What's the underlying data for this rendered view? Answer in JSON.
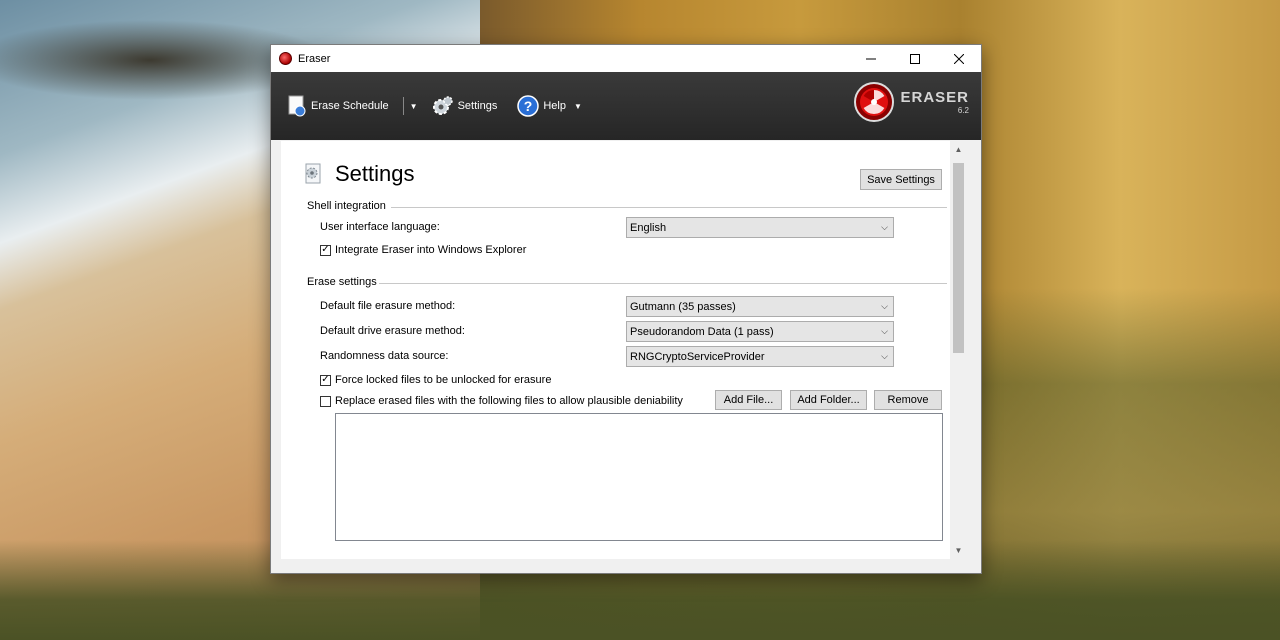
{
  "window": {
    "title": "Eraser"
  },
  "toolbar": {
    "erase_schedule": "Erase Schedule",
    "settings": "Settings",
    "help": "Help",
    "brand_name": "ERASER",
    "brand_version": "6.2"
  },
  "page": {
    "heading": "Settings",
    "save_button": "Save Settings"
  },
  "shell": {
    "title": "Shell integration",
    "language_label": "User interface language:",
    "language_value": "English",
    "integrate_label": "Integrate Eraser into Windows Explorer",
    "integrate_checked": true
  },
  "erase": {
    "title": "Erase settings",
    "file_method_label": "Default file erasure method:",
    "file_method_value": "Gutmann (35 passes)",
    "drive_method_label": "Default drive erasure method:",
    "drive_method_value": "Pseudorandom Data (1 pass)",
    "random_source_label": "Randomness data source:",
    "random_source_value": "RNGCryptoServiceProvider",
    "force_unlock_label": "Force locked files to be unlocked for erasure",
    "force_unlock_checked": true,
    "replace_label": "Replace erased files with the following files to allow plausible deniability",
    "replace_checked": false,
    "add_file": "Add File...",
    "add_folder": "Add Folder...",
    "remove": "Remove"
  }
}
